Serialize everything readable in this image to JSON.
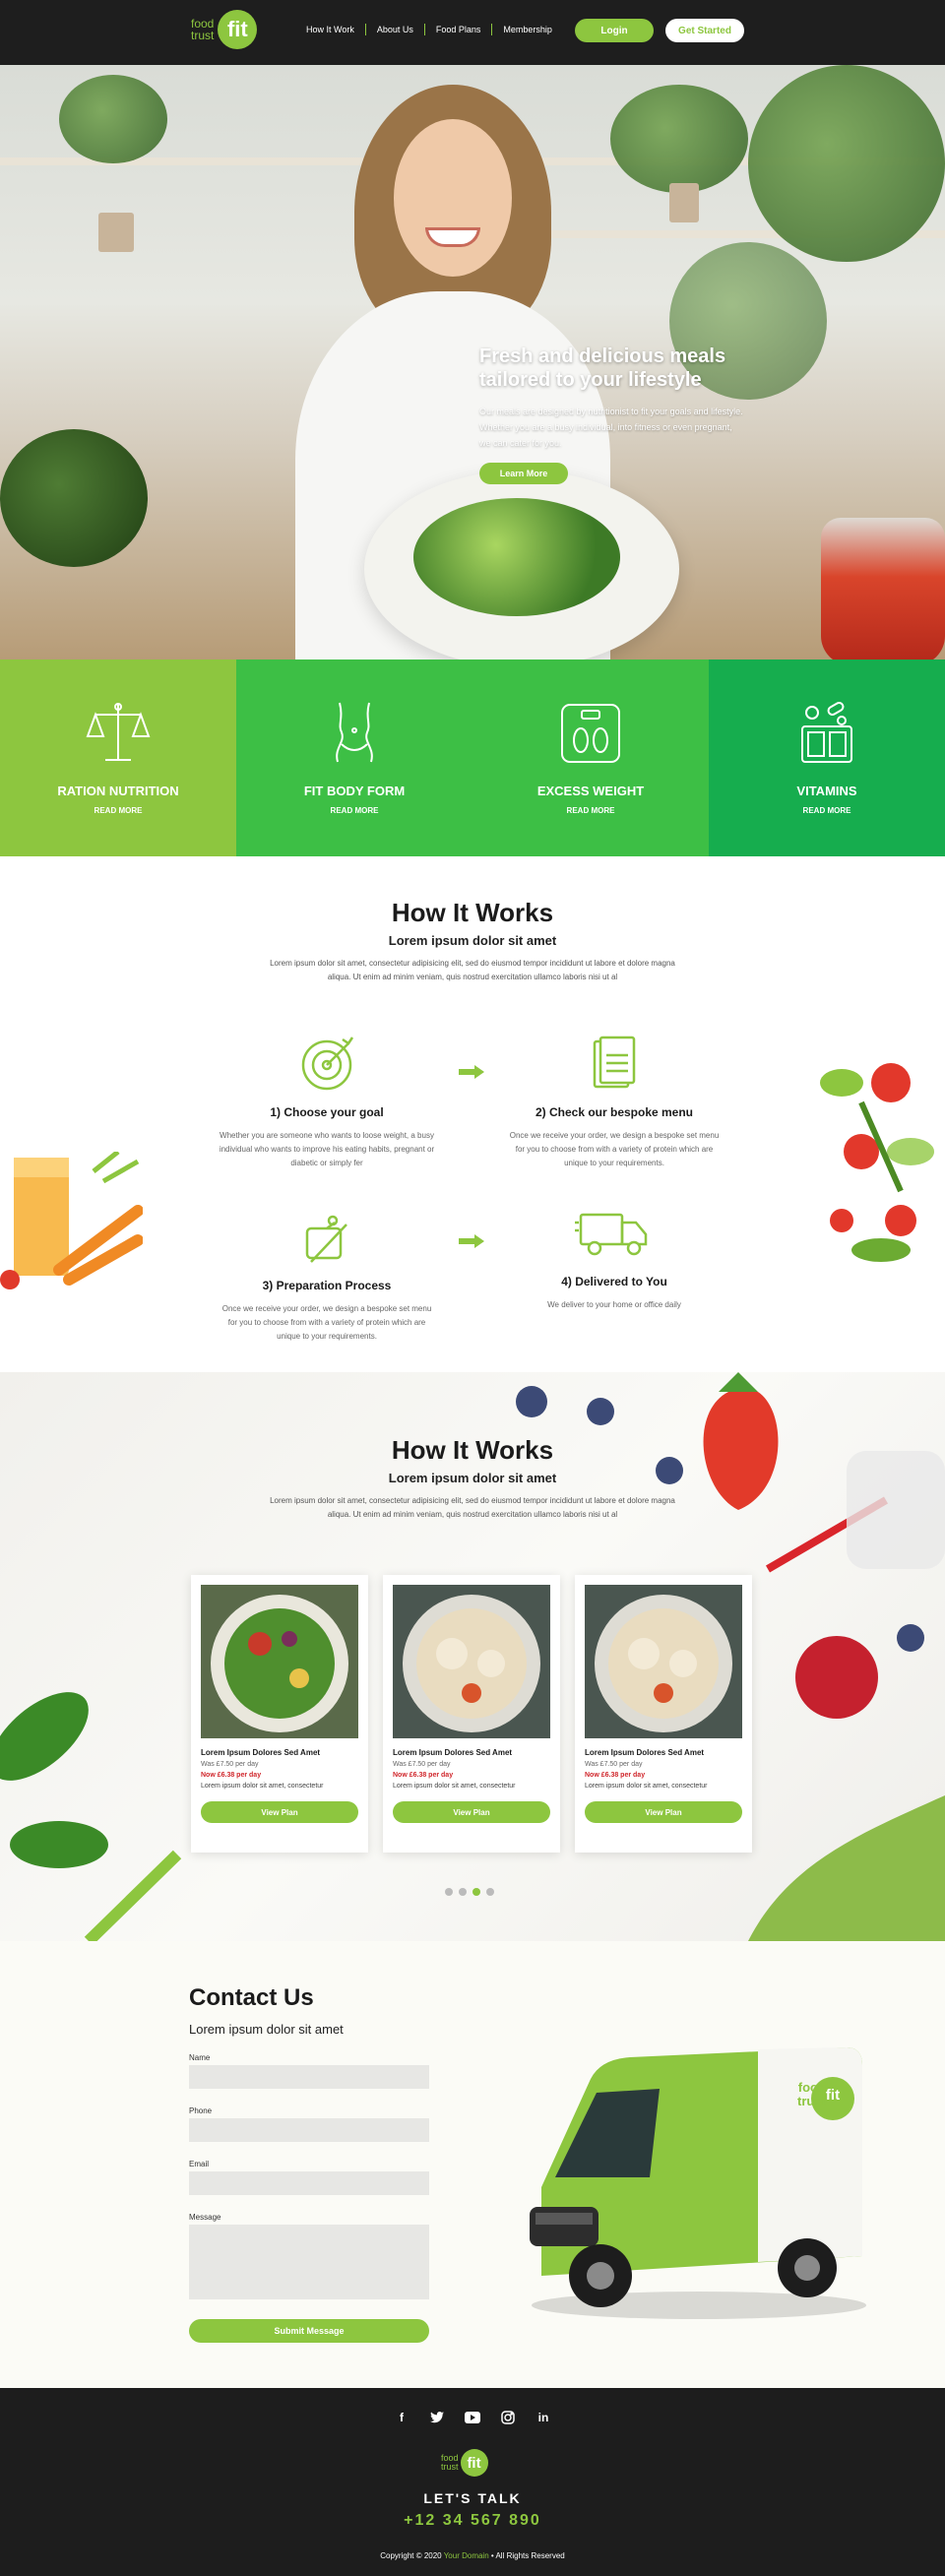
{
  "brand": {
    "logo_line1": "food",
    "logo_line2": "trust",
    "logo_badge": "fit",
    "accent": "#8dc63f"
  },
  "nav": {
    "links": [
      "How It Work",
      "About Us",
      "Food Plans",
      "Membership"
    ],
    "login_label": "Login",
    "start_label": "Get Started"
  },
  "hero": {
    "title": "Fresh and delicious meals tailored to your lifestyle",
    "description": "Our meals are designed by nutritionist to fit your goals and lifestyle. Whether you are a busy individual, into fitness or even pregnant, we can cater for you.",
    "button_label": "Learn More"
  },
  "features": [
    {
      "title": "RATION NUTRITION",
      "more": "READ MORE",
      "icon": "scale-icon",
      "color": "#8dc63f"
    },
    {
      "title": "FIT BODY FORM",
      "more": "READ MORE",
      "icon": "body-icon",
      "color": "#3dbf45"
    },
    {
      "title": "EXCESS WEIGHT",
      "more": "READ MORE",
      "icon": "weighing-scale-icon",
      "color": "#3dbf45"
    },
    {
      "title": "VITAMINS",
      "more": "READ MORE",
      "icon": "vitamins-icon",
      "color": "#16ad4e"
    }
  ],
  "how_it_works": {
    "title": "How It Works",
    "subtitle": "Lorem ipsum dolor sit amet",
    "description": "Lorem ipsum dolor sit amet, consectetur adipisicing elit, sed do eiusmod tempor incididunt ut labore et dolore magna aliqua. Ut enim ad minim veniam, quis nostrud exercitation ullamco laboris nisi ut al",
    "steps": [
      {
        "title": "1) Choose your goal",
        "desc": "Whether you are someone who wants to loose weight, a busy individual who wants to improve his eating habits, pregnant or diabetic or simply fer",
        "icon": "target-icon"
      },
      {
        "title": "2) Check our bespoke menu",
        "desc": "Once we receive your order, we design a bespoke set menu for you to choose from with a variety of protein which are unique to your requirements.",
        "icon": "menu-icon"
      },
      {
        "title": "3) Preparation Process",
        "desc": "Once we receive your order, we design a bespoke set menu for you to choose from with a variety of protein which are unique to your requirements.",
        "icon": "cutting-board-icon"
      },
      {
        "title": "4) Delivered to You",
        "desc": "We deliver to your home or office daily",
        "icon": "truck-icon"
      }
    ]
  },
  "plans": {
    "title": "How It Works",
    "subtitle": "Lorem ipsum dolor sit amet",
    "description": "Lorem ipsum dolor sit amet, consectetur adipisicing elit, sed do eiusmod tempor incididunt ut labore et dolore magna aliqua. Ut enim ad minim veniam, quis nostrud exercitation ullamco laboris nisi ut al",
    "cards": [
      {
        "title": "Lorem Ipsum Dolores Sed Amet",
        "was": "Was £7.50 per day",
        "now": "Now £6.38 per day",
        "text": "Lorem ipsum dolor sit amet, consectetur",
        "button": "View Plan"
      },
      {
        "title": "Lorem Ipsum Dolores Sed Amet",
        "was": "Was £7.50 per day",
        "now": "Now £6.38 per day",
        "text": "Lorem ipsum dolor sit amet, consectetur",
        "button": "View Plan"
      },
      {
        "title": "Lorem Ipsum Dolores Sed Amet",
        "was": "Was £7.50 per day",
        "now": "Now £6.38 per day",
        "text": "Lorem ipsum dolor sit amet, consectetur",
        "button": "View Plan"
      }
    ],
    "active_dot": 2
  },
  "contact": {
    "title": "Contact Us",
    "subtitle": "Lorem ipsum dolor sit amet",
    "name_label": "Name",
    "phone_label": "Phone",
    "email_label": "Email",
    "message_label": "Message",
    "submit_label": "Submit Message",
    "van_logo_line1": "food",
    "van_logo_line2": "trust",
    "van_logo_badge": "fit"
  },
  "footer": {
    "socials": [
      "facebook-icon",
      "twitter-icon",
      "youtube-icon",
      "instagram-icon",
      "linkedin-icon"
    ],
    "lets_talk": "LET'S TALK",
    "phone": "+12 34 567 890",
    "copyright_pre": "Copyright © 2020",
    "copyright_domain": "Your Domain",
    "copyright_post": "• All Rights Reserved"
  }
}
